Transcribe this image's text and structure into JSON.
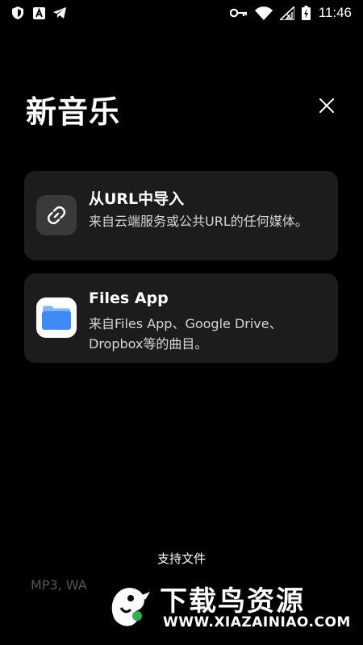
{
  "status_bar": {
    "time": "11:46",
    "left_icons": [
      "shield-icon",
      "font-a-icon",
      "send-icon"
    ],
    "right_icons": [
      "key-icon",
      "wifi-icon",
      "signal-icon",
      "battery-icon"
    ]
  },
  "header": {
    "title": "新音乐",
    "close_icon": "close-icon"
  },
  "options": [
    {
      "icon": "link-icon",
      "title": "从URL中导入",
      "description": "来自云端服务或公共URL的任何媒体。"
    },
    {
      "icon": "folder-icon",
      "title": "Files App",
      "description": "来自Files App、Google Drive、Dropbox等的曲目。"
    }
  ],
  "footer": {
    "supported_label": "支持文件",
    "formats_text": "MP3, WA"
  },
  "watermark": {
    "title": "下载鸟资源",
    "url": "WWW.XIAZAINIAO.COM"
  },
  "colors": {
    "background": "#000000",
    "card": "#1c1c1e",
    "folder_blue": "#3d8bf7"
  }
}
